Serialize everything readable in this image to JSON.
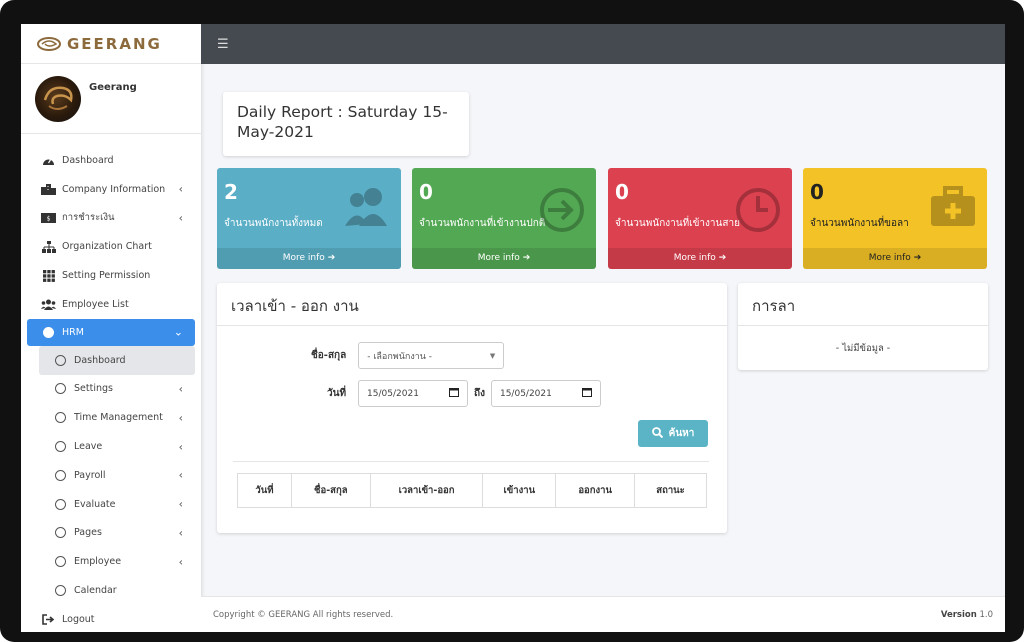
{
  "brand": {
    "name": "GEERANG"
  },
  "user": {
    "name": "Geerang"
  },
  "sidebar": {
    "items": [
      {
        "label": "Dashboard",
        "icon": "tachometer-icon"
      },
      {
        "label": "Company Information",
        "icon": "building-icon",
        "has_children": true
      },
      {
        "label": "การชำระเงิน",
        "icon": "money-bill-icon",
        "has_children": true
      },
      {
        "label": "Organization Chart",
        "icon": "sitemap-icon"
      },
      {
        "label": "Setting Permission",
        "icon": "grid-icon"
      },
      {
        "label": "Employee List",
        "icon": "users-icon"
      },
      {
        "label": "HRM",
        "icon": "circle-icon",
        "active": true
      },
      {
        "label": "Dashboard",
        "icon": "circle-outline-icon",
        "sub": true,
        "selected": true
      },
      {
        "label": "Settings",
        "icon": "circle-outline-icon",
        "sub": true,
        "has_children": true
      },
      {
        "label": "Time Management",
        "icon": "circle-outline-icon",
        "sub": true,
        "has_children": true
      },
      {
        "label": "Leave",
        "icon": "circle-outline-icon",
        "sub": true,
        "has_children": true
      },
      {
        "label": "Payroll",
        "icon": "circle-outline-icon",
        "sub": true,
        "has_children": true
      },
      {
        "label": "Evaluate",
        "icon": "circle-outline-icon",
        "sub": true,
        "has_children": true
      },
      {
        "label": "Pages",
        "icon": "circle-outline-icon",
        "sub": true,
        "has_children": true
      },
      {
        "label": "Employee",
        "icon": "circle-outline-icon",
        "sub": true,
        "has_children": true
      },
      {
        "label": "Calendar",
        "icon": "circle-outline-icon",
        "sub": true
      },
      {
        "label": "Logout",
        "icon": "sign-out-icon"
      }
    ]
  },
  "report": {
    "title": "Daily Report : Saturday 15-May-2021"
  },
  "stats": [
    {
      "count": "2",
      "label": "จำนวนพนักงานทั้งหมด",
      "more": "More info",
      "color": "#5aaec6"
    },
    {
      "count": "0",
      "label": "จำนวนพนักงานที่เข้างานปกติ",
      "more": "More info",
      "color": "#53a853"
    },
    {
      "count": "0",
      "label": "จำนวนพนักงานที่เข้างานสาย",
      "more": "More info",
      "color": "#dc4150"
    },
    {
      "count": "0",
      "label": "จำนวนพนักงานที่ขอลา",
      "more": "More info",
      "color": "#f3c227"
    }
  ],
  "attendance": {
    "title": "เวลาเข้า - ออก งาน",
    "name_label": "ชื่อ-สกุล",
    "name_select": "- เลือกพนักงาน -",
    "date_label": "วันที่",
    "date_from": "15/05/2021",
    "to_label": "ถึง",
    "date_to": "15/05/2021",
    "search_label": "ค้นหา",
    "columns": [
      "วันที่",
      "ชื่อ-สกุล",
      "เวลาเข้า-ออก",
      "เข้างาน",
      "ออกงาน",
      "สถานะ"
    ]
  },
  "leave": {
    "title": "การลา",
    "empty": "- ไม่มีข้อมูล -"
  },
  "footer": {
    "copyright": "Copyright © GEERANG All rights reserved.",
    "version_label": "Version",
    "version": "1.0"
  }
}
